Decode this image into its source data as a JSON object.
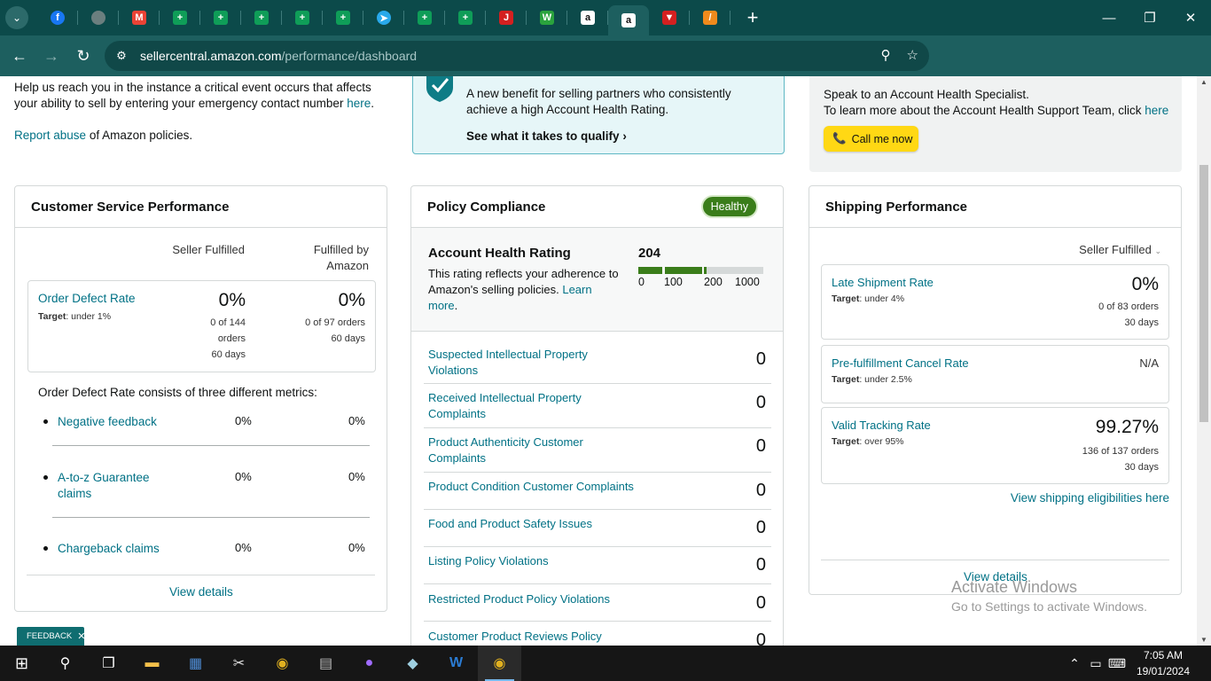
{
  "browser": {
    "tabs": [
      {
        "icon": "facebook-icon",
        "color": "#1877f2",
        "glyph": "f"
      },
      {
        "icon": "globe-icon",
        "color": "#6b7f7f",
        "glyph": ""
      },
      {
        "icon": "gmail-icon",
        "color": "#ea4335",
        "glyph": "M"
      },
      {
        "icon": "sheets-icon",
        "color": "#0f9d58",
        "glyph": "+"
      },
      {
        "icon": "sheets-icon",
        "color": "#0f9d58",
        "glyph": "+"
      },
      {
        "icon": "sheets-icon",
        "color": "#0f9d58",
        "glyph": "+"
      },
      {
        "icon": "sheets-icon",
        "color": "#0f9d58",
        "glyph": "+"
      },
      {
        "icon": "sheets-icon",
        "color": "#0f9d58",
        "glyph": "+"
      },
      {
        "icon": "telegram-icon",
        "color": "#29a9eb",
        "glyph": "➤"
      },
      {
        "icon": "sheets-icon",
        "color": "#0f9d58",
        "glyph": "+"
      },
      {
        "icon": "sheets-icon",
        "color": "#0f9d58",
        "glyph": "+"
      },
      {
        "icon": "jumia-icon",
        "color": "#d42020",
        "glyph": "J"
      },
      {
        "icon": "wise-icon",
        "color": "#2aa33d",
        "glyph": "W"
      },
      {
        "icon": "amazon-icon",
        "color": "#ffffff",
        "glyph": "a"
      },
      {
        "icon": "amazon-icon",
        "color": "#ffffff",
        "glyph": "a",
        "active": true
      },
      {
        "icon": "red-arrow-icon",
        "color": "#d42020",
        "glyph": "▼"
      },
      {
        "icon": "app-icon",
        "color": "#f08a1c",
        "glyph": "/"
      }
    ],
    "url_host": "sellercentral.amazon.com",
    "url_path": "/performance/dashboard"
  },
  "top": {
    "emergency_line1": "Help us reach you in the instance a critical event occurs that affects",
    "emergency_line2": "your ability to sell by entering your emergency contact number",
    "here": "here",
    "period": ".",
    "report_abuse": "Report abuse",
    "report_rest": " of Amazon policies."
  },
  "benefit": {
    "line1": "A new benefit for selling partners who consistently",
    "line2": "achieve a high Account Health Rating.",
    "qualify": "See what it takes to qualify"
  },
  "ahs": {
    "line1": "Speak to an Account Health Specialist.",
    "line2": "To learn more about the Account Health Support Team, click",
    "here": "here",
    "call": "Call me now"
  },
  "customer_service": {
    "title": "Customer Service Performance",
    "col1": "Seller Fulfilled",
    "col2_l1": "Fulfilled by",
    "col2_l2": "Amazon",
    "odr_title": "Order Defect Rate",
    "odr_target_label": "Target",
    "odr_target": ": under 1%",
    "sf_pct": "0%",
    "sf_l1": "0 of 144",
    "sf_l2": "orders",
    "sf_l3": "60 days",
    "fba_pct": "0%",
    "fba_l1": "0 of 97 orders",
    "fba_l2": "60 days",
    "intro": "Order Defect Rate consists of three different metrics:",
    "metrics": [
      {
        "l1": "Negative feedback",
        "l2": "",
        "sf": "0%",
        "fba": "0%"
      },
      {
        "l1": "A-to-z Guarantee",
        "l2": "claims",
        "sf": "0%",
        "fba": "0%"
      },
      {
        "l1": "Chargeback claims",
        "l2": "",
        "sf": "0%",
        "fba": "0%"
      }
    ],
    "view_details": "View details"
  },
  "policy": {
    "title": "Policy Compliance",
    "badge": "Healthy",
    "ahr_title": "Account Health Rating",
    "ahr_desc_1": "This rating reflects your adherence",
    "ahr_desc_2": "to Amazon's selling policies.",
    "learn": "Learn",
    "more": "more",
    "dot": ".",
    "score": "204",
    "score_value": 204,
    "scale": [
      "0",
      "100",
      "200",
      "1000"
    ],
    "rows": [
      {
        "l1": "Suspected Intellectual Property",
        "l2": "Violations",
        "v": "0"
      },
      {
        "l1": "Received Intellectual Property",
        "l2": "Complaints",
        "v": "0"
      },
      {
        "l1": "Product Authenticity Customer",
        "l2": "Complaints",
        "v": "0"
      },
      {
        "l1": "Product Condition Customer Complaints",
        "l2": "",
        "v": "0"
      },
      {
        "l1": "Food and Product Safety Issues",
        "l2": "",
        "v": "0"
      },
      {
        "l1": "Listing Policy Violations",
        "l2": "",
        "v": "0"
      },
      {
        "l1": "Restricted Product Policy Violations",
        "l2": "",
        "v": "0"
      },
      {
        "l1": "Customer Product Reviews Policy",
        "l2": "",
        "v": "0"
      }
    ]
  },
  "shipping": {
    "title": "Shipping Performance",
    "select": "Seller Fulfilled",
    "late_title": "Late Shipment Rate",
    "late_target": ": under 4%",
    "late_val": "0%",
    "late_l1": "0 of 83 orders",
    "late_l2": "30 days",
    "cancel_title": "Pre-fulfillment Cancel Rate",
    "cancel_target": ": under 2.5%",
    "cancel_val": "N/A",
    "vtr_title": "Valid Tracking Rate",
    "vtr_target": ": over 95%",
    "vtr_val": "99.27%",
    "vtr_l1": "136 of 137 orders",
    "vtr_l2": "30 days",
    "target_label": "Target",
    "eligibility": "View shipping eligibilities here",
    "view_details": "View details"
  },
  "watermark": {
    "l1": "Activate Windows",
    "l2": "Go to Settings to activate Windows."
  },
  "feedback": "FEEDBACK",
  "clock": {
    "time": "7:05 AM",
    "date": "19/01/2024"
  }
}
